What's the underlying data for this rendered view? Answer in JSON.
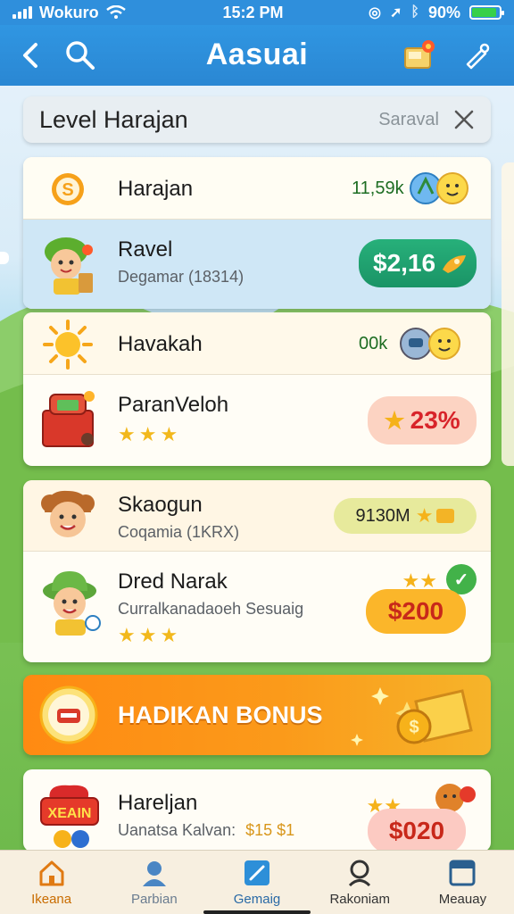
{
  "status_bar": {
    "carrier": "Wokuro",
    "time": "15:2 PM",
    "battery": "90%",
    "battery_level": 0.9
  },
  "app_bar": {
    "title": "Aasuai"
  },
  "search": {
    "query": "Level Harajan",
    "placeholder": "Saraval"
  },
  "card1": {
    "rows": [
      {
        "name": "Harajan",
        "value": "11,59k"
      },
      {
        "name": "Ravel",
        "sub": "Degamar (18314)",
        "value": "$2,16"
      }
    ]
  },
  "card2": {
    "rows": [
      {
        "name": "Havakah",
        "value": "00k"
      },
      {
        "name": "ParanVeloh",
        "value": "23%",
        "stars": 3
      }
    ]
  },
  "card3": {
    "rows": [
      {
        "name": "Skaogun",
        "sub": "Coqamia (1KRX)",
        "value": "9130M"
      },
      {
        "name": "Dred Narak",
        "sub": "Curralkanadaoeh Sesuaig",
        "value": "$200",
        "stars": 3
      }
    ]
  },
  "bonus": {
    "label": "HADIKAN BONUS"
  },
  "card4": {
    "rows": [
      {
        "name": "Hareljan",
        "sub": "Uanatsa Kalvan:",
        "sub_value": "$15 $1",
        "value": "$020",
        "badge": "XEAIN"
      }
    ]
  },
  "bottom_nav": {
    "items": [
      {
        "label": "Ikeana",
        "active": true
      },
      {
        "label": "Parbian"
      },
      {
        "label": "Gemaig"
      },
      {
        "label": "Rakoniam"
      },
      {
        "label": "Meauay"
      }
    ]
  },
  "colors": {
    "primary": "#2f8fdc",
    "accent": "#ff8a12",
    "success": "#1fa76c"
  }
}
